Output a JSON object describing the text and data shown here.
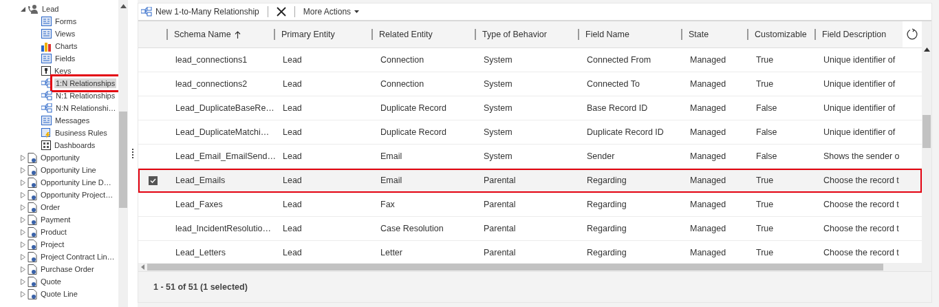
{
  "sidebar": {
    "items": [
      {
        "label": "Lead",
        "expanded": true,
        "children": [
          {
            "label": "Forms",
            "selected": false,
            "annotated": false
          },
          {
            "label": "Views",
            "selected": false,
            "annotated": false
          },
          {
            "label": "Charts",
            "selected": false,
            "annotated": false
          },
          {
            "label": "Fields",
            "selected": false,
            "annotated": false
          },
          {
            "label": "Keys",
            "selected": false,
            "annotated": false
          },
          {
            "label": "1:N Relationships",
            "selected": true,
            "annotated": true
          },
          {
            "label": "N:1 Relationships",
            "selected": false,
            "annotated": false
          },
          {
            "label": "N:N Relationshi…",
            "selected": false,
            "annotated": false
          },
          {
            "label": "Messages",
            "selected": false,
            "annotated": false
          },
          {
            "label": "Business Rules",
            "selected": false,
            "annotated": false
          },
          {
            "label": "Dashboards",
            "selected": false,
            "annotated": false
          }
        ]
      },
      {
        "label": "Opportunity",
        "expanded": false
      },
      {
        "label": "Opportunity Line",
        "expanded": false
      },
      {
        "label": "Opportunity Line D…",
        "expanded": false
      },
      {
        "label": "Opportunity Project…",
        "expanded": false
      },
      {
        "label": "Order",
        "expanded": false
      },
      {
        "label": "Payment",
        "expanded": false
      },
      {
        "label": "Product",
        "expanded": false
      },
      {
        "label": "Project",
        "expanded": false
      },
      {
        "label": "Project Contract Lin…",
        "expanded": false
      },
      {
        "label": "Purchase Order",
        "expanded": false
      },
      {
        "label": "Quote",
        "expanded": false
      },
      {
        "label": "Quote Line",
        "expanded": false
      }
    ]
  },
  "toolbar": {
    "new_button": "New 1-to-Many Relationship",
    "more_actions": "More Actions"
  },
  "table": {
    "columns": [
      {
        "label": "Schema Name",
        "sorted": true
      },
      {
        "label": "Primary Entity",
        "sorted": false
      },
      {
        "label": "Related Entity",
        "sorted": false
      },
      {
        "label": "Type of Behavior",
        "sorted": false
      },
      {
        "label": "Field Name",
        "sorted": false
      },
      {
        "label": "State",
        "sorted": false
      },
      {
        "label": "Customizable",
        "sorted": false
      },
      {
        "label": "Field Description",
        "sorted": false
      }
    ],
    "rows": [
      {
        "selected": false,
        "annotated": false,
        "cells": [
          "lead_connections1",
          "Lead",
          "Connection",
          "System",
          "Connected From",
          "Managed",
          "True",
          "Unique identifier of"
        ]
      },
      {
        "selected": false,
        "annotated": false,
        "cells": [
          "lead_connections2",
          "Lead",
          "Connection",
          "System",
          "Connected To",
          "Managed",
          "True",
          "Unique identifier of"
        ]
      },
      {
        "selected": false,
        "annotated": false,
        "cells": [
          "Lead_DuplicateBaseRe…",
          "Lead",
          "Duplicate Record",
          "System",
          "Base Record ID",
          "Managed",
          "False",
          "Unique identifier of"
        ]
      },
      {
        "selected": false,
        "annotated": false,
        "cells": [
          "Lead_DuplicateMatchi…",
          "Lead",
          "Duplicate Record",
          "System",
          "Duplicate Record ID",
          "Managed",
          "False",
          "Unique identifier of"
        ]
      },
      {
        "selected": false,
        "annotated": false,
        "cells": [
          "Lead_Email_EmailSend…",
          "Lead",
          "Email",
          "System",
          "Sender",
          "Managed",
          "False",
          "Shows the sender o"
        ]
      },
      {
        "selected": true,
        "annotated": true,
        "cells": [
          "Lead_Emails",
          "Lead",
          "Email",
          "Parental",
          "Regarding",
          "Managed",
          "True",
          "Choose the record t"
        ]
      },
      {
        "selected": false,
        "annotated": false,
        "cells": [
          "Lead_Faxes",
          "Lead",
          "Fax",
          "Parental",
          "Regarding",
          "Managed",
          "True",
          "Choose the record t"
        ]
      },
      {
        "selected": false,
        "annotated": false,
        "cells": [
          "lead_IncidentResolutio…",
          "Lead",
          "Case Resolution",
          "Parental",
          "Regarding",
          "Managed",
          "True",
          "Choose the record t"
        ]
      },
      {
        "selected": false,
        "annotated": false,
        "cells": [
          "Lead_Letters",
          "Lead",
          "Letter",
          "Parental",
          "Regarding",
          "Managed",
          "True",
          "Choose the record t"
        ]
      }
    ]
  },
  "status_bar": "1 - 51 of 51 (1 selected)"
}
